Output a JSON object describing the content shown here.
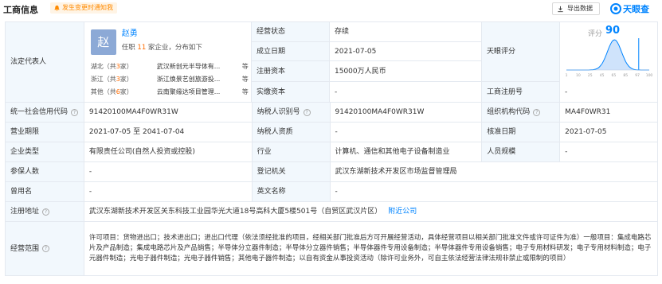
{
  "header": {
    "title": "工商信息",
    "notify_label": "发生变更时通知我",
    "export_label": "导出数据",
    "brand": "天眼查"
  },
  "rep": {
    "label": "法定代表人",
    "avatar_char": "赵",
    "name": "赵勇",
    "sub_prefix": "任职 ",
    "sub_count": "11",
    "sub_suffix": " 家企业，分布如下",
    "regions": [
      {
        "name": "湖北",
        "prefix": "（共",
        "count": "3",
        "suffix": "家）",
        "company": "武汉新创元半导体有...",
        "more": "等"
      },
      {
        "name": "浙江",
        "prefix": "（共",
        "count": "3",
        "suffix": "家）",
        "company": "浙江焕景艺创旅游投...",
        "more": "等"
      },
      {
        "name": "其他",
        "prefix": "（共",
        "count": "6",
        "suffix": "家）",
        "company": "云南聚缘达项目管理...",
        "more": "等"
      }
    ]
  },
  "rows": {
    "status_label": "经营状态",
    "status": "存续",
    "rating_label": "天眼评分",
    "score_label": "评分",
    "score": "90",
    "founded_label": "成立日期",
    "founded": "2021-07-05",
    "capital_label": "注册资本",
    "capital": "15000万人民币",
    "paid_label": "实缴资本",
    "paid": "-",
    "regno_label": "工商注册号",
    "regno": "-",
    "credit_label": "统一社会信用代码",
    "credit": "91420100MA4F0WR31W",
    "taxid_label": "纳税人识别号",
    "taxid": "91420100MA4F0WR31W",
    "org_label": "组织机构代码",
    "org": "MA4F0WR31",
    "term_label": "营业期限",
    "term_start": "2021-07-05",
    "term_to": "至",
    "term_end": "2041-07-04",
    "taxq_label": "纳税人资质",
    "taxq": "-",
    "approve_label": "核准日期",
    "approve": "2021-07-05",
    "type_label": "企业类型",
    "type": "有限责任公司(自然人投资或控股)",
    "industry_label": "行业",
    "industry": "计算机、通信和其他电子设备制造业",
    "staff_label": "人员规模",
    "staff": "-",
    "insured_label": "参保人数",
    "insured": "-",
    "authority_label": "登记机关",
    "authority": "武汉东湖新技术开发区市场监督管理局",
    "former_label": "曾用名",
    "former": "-",
    "english_label": "英文名称",
    "english": "-",
    "address_label": "注册地址",
    "address": "武汉东湖新技术开发区关东科技工业园华光大道18号高科大厦5楼501号（自贸区武汉片区）",
    "address_link": "附近公司",
    "scope_label": "经营范围",
    "scope": "许可项目：货物进出口；技术进出口；进出口代理（依法须经批准的项目，经相关部门批准后方可开展经营活动，具体经营项目以相关部门批准文件或许可证件为准）一般项目：集成电路芯片及产品制造；集成电路芯片及产品销售；半导体分立器件制造；半导体分立器件销售；半导体器件专用设备制造；半导体器件专用设备销售；电子专用材料研发；电子专用材料制造；电子元器件制造；光电子器件制造；光电子器件销售；其他电子器件制造；以自有资金从事投资活动（除许可业务外，可自主依法经营法律法规非禁止或限制的项目）"
  },
  "score_chart": {
    "ticks": [
      "1",
      "10",
      "25",
      "45",
      "65",
      "85",
      "97",
      "100"
    ],
    "score": 90,
    "colors": {
      "accent": "#0084ff",
      "fill": "#cfe3fb"
    }
  }
}
